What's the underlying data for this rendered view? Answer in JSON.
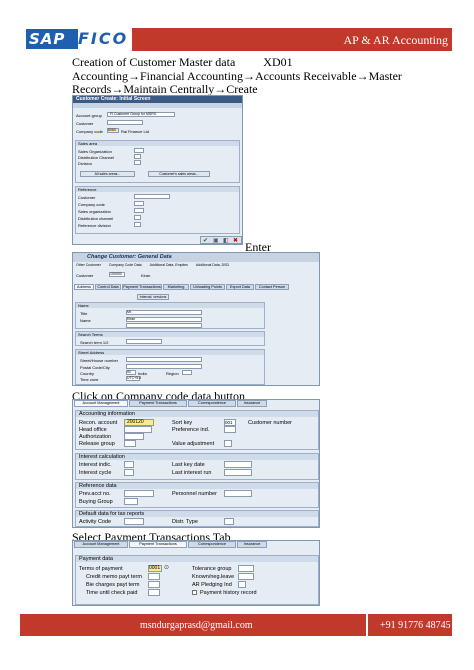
{
  "header": {
    "logo_sap": "SAP",
    "logo_fico": "FICO",
    "title": "AP & AR Accounting"
  },
  "section1": {
    "title": "Creation of Customer Master data",
    "code": "XD01",
    "path1": "Accounting→Financial Accounting→Accounts Receivable→Master",
    "path2": "Records→Maintain Centrally→Create"
  },
  "win1": {
    "title": "Customer Create: Initial Screen",
    "account_group_label": "Account group",
    "account_group_value": "FI Customer Group for MSRS",
    "customer_label": "Customer",
    "company_code_label": "Company code",
    "company_code_value": "6060",
    "company_name": "Rai Finance Ltd",
    "sales_area": "Sales area",
    "sales_org": "Sales Organization",
    "dist_channel": "Distribution Channel",
    "division": "Division",
    "all_sales_btn": "All sales areas...",
    "cust_sales_btn": "Customer's sales areas...",
    "reference": "Reference",
    "ref_customer": "Customer",
    "ref_company": "Company code",
    "ref_sales_org": "Sales organization",
    "ref_dist": "Distribution channel",
    "ref_div": "Reference division"
  },
  "enter_label": "Enter",
  "win2": {
    "title": "Change Customer: General Data",
    "toolbar": [
      "Other Customer",
      "Company Code Data",
      "Additional Data, Empties",
      "Additional Data, DSD"
    ],
    "customer_label": "Customer",
    "customer_value": "100000",
    "customer_name": "Kiran",
    "tabs": [
      "Address",
      "Control Data",
      "Payment Transactions",
      "Marketing",
      "Unloading Points",
      "Export Data",
      "Contact Person"
    ],
    "intl_btn": "Internal. versions",
    "name_section": "Name",
    "title_label": "Title",
    "title_value": "Mr.",
    "name_label": "Name",
    "name_value": "Kiran",
    "search_section": "Search Terms",
    "search_label": "Search term 1/2",
    "street_section": "Street Address",
    "street_label": "Street/House number",
    "postal_label": "Postal Code/City",
    "country_label": "Country",
    "country_value": "IN",
    "country_name": "India",
    "region_label": "Region",
    "region_value": "",
    "timezone_label": "Time zone",
    "timezone_value": "UTC+5:3"
  },
  "caption2": "Click on Company code data button",
  "win3": {
    "tabs": [
      "Account Management",
      "Payment Transactions",
      "Correspondence",
      "Insurance"
    ],
    "acc_info": "Accounting information",
    "recon_label": "Recon. account",
    "recon_value": "200120",
    "sort_label": "Sort key",
    "sort_value": "001",
    "cust_num_label": "Customer number",
    "head_office": "Head office",
    "pref_ind": "Preference ind.",
    "authorization": "Authorization",
    "release_group": "Release group",
    "value_adj": "Value adjustment",
    "interest_calc": "Interest calculation",
    "interest_indic": "Interest indic.",
    "last_key_date": "Last key date",
    "interest_cycle": "Interest cycle",
    "last_interest_run": "Last interest run",
    "reference_data": "Reference data",
    "prev_acct": "Prev.acct no.",
    "personnel_number": "Personnel number",
    "buying_group": "Buying Group",
    "default_data": "Default data for tax reports",
    "activity_code": "Activity Code",
    "distr_type": "Distr. Type"
  },
  "caption3": "Select Payment Transactions Tab",
  "win4": {
    "tabs": [
      "Account Management",
      "Payment Transactions",
      "Correspondence",
      "Insurance"
    ],
    "payment_data": "Payment data",
    "terms_label": "Terms of payment",
    "terms_value": "0001",
    "tolerance": "Tolerance group",
    "credit_memo": "Credit memo payt term",
    "known_leave": "Known/neg.leave",
    "bie_charges": "Bie charges payt term",
    "ar_pledging": "AR Pledging Ind",
    "time_until": "Time until check paid",
    "payment_history": "Payment history record"
  },
  "footer": {
    "email": "msndurgaprasd@gmail.com",
    "phone": "+91 91776 48745"
  }
}
